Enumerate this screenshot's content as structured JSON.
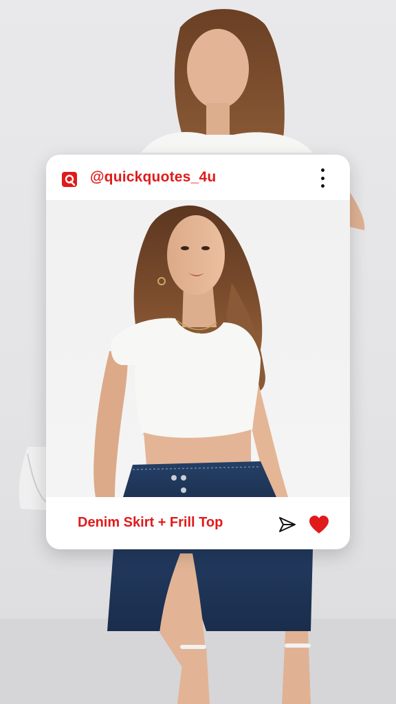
{
  "post": {
    "username": "@quickquotes_4u",
    "caption": "Denim Skirt + Frill Top"
  },
  "icons": {
    "logo": "quickquotes-logo-icon",
    "more": "more-vertical-icon",
    "send": "send-icon",
    "like": "heart-icon"
  },
  "colors": {
    "accent": "#e01a1a",
    "card": "#ffffff",
    "background": "#e6e6e8",
    "denim": "#1f3557",
    "top": "#f6f6f4",
    "hair": "#6b4226",
    "skin": "#e7b99b"
  }
}
